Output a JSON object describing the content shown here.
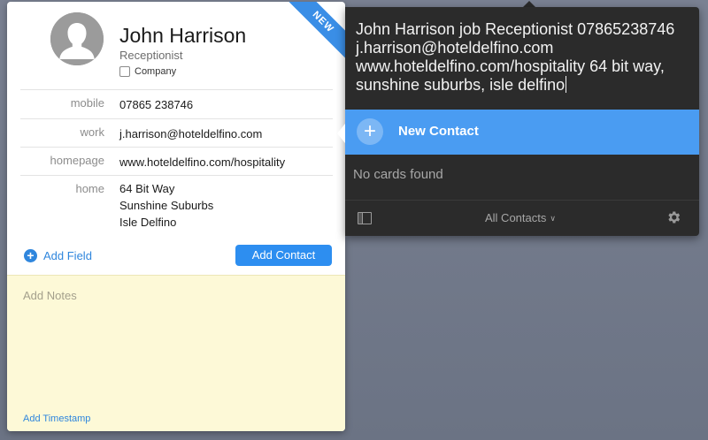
{
  "contact_card": {
    "ribbon": "NEW",
    "name": "John Harrison",
    "job_title": "Receptionist",
    "company_label": "Company",
    "fields": [
      {
        "label": "mobile",
        "value": "07865 238746"
      },
      {
        "label": "work",
        "value": "j.harrison@hoteldelfino.com"
      },
      {
        "label": "homepage",
        "value": "www.hoteldelfino.com/hospitality"
      },
      {
        "label": "home",
        "lines": [
          "64 Bit Way",
          "Sunshine Suburbs",
          "Isle Delfino"
        ]
      }
    ],
    "add_field_label": "Add Field",
    "add_contact_label": "Add Contact",
    "notes_placeholder": "Add Notes",
    "add_timestamp_label": "Add Timestamp"
  },
  "search_popover": {
    "query": "John Harrison job Receptionist 07865238746 j.harrison@hoteldelfino.com www.hoteldelfino.com/hospitality 64 bit way, sunshine suburbs, isle delfino",
    "result_label": "New Contact",
    "empty_message": "No cards found",
    "filter_label": "All Contacts",
    "icons": {
      "sidebar": "sidebar-toggle-icon",
      "settings": "gear-icon",
      "add": "plus-icon",
      "filter": "chevron-down-icon"
    }
  },
  "colors": {
    "accent": "#2d8ef0",
    "selected_row": "#4a9cf2",
    "popover_bg": "#2b2b2b",
    "notes_bg": "#fdf9d7",
    "ribbon": "#3a8ee6"
  }
}
